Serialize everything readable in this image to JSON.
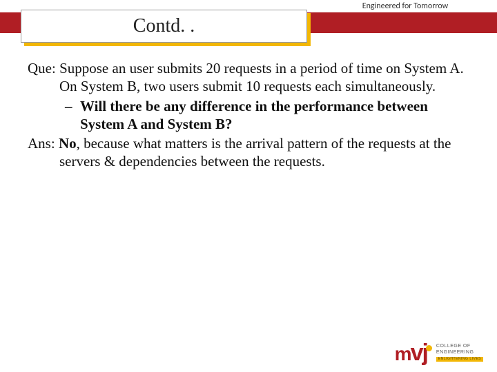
{
  "header": {
    "tagline": "Engineered for Tomorrow",
    "title": "Contd. ."
  },
  "body": {
    "que_label": "Que:",
    "que_text": "Suppose an user  submits 20 requests in a period of time on System A. On System B, two users submit 10 requests each simultaneously.",
    "bullet_dash": "–",
    "bullet_text": "Will there be any difference in the performance between System A and System B?",
    "ans_label": "Ans:",
    "ans_no": "No",
    "ans_text": ", because what matters is the arrival pattern of the requests at the servers & dependencies between the requests."
  },
  "logo": {
    "m": "m",
    "vj": "vj",
    "line1": "COLLEGE OF",
    "line2": "ENGINEERING",
    "sub": "ENLIGHTENING LIVES"
  }
}
